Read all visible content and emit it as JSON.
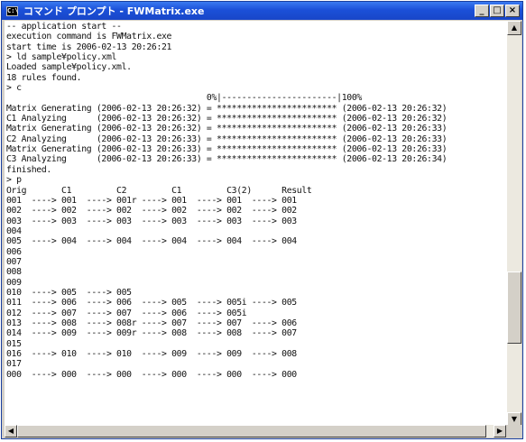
{
  "window": {
    "title": "コマンド プロンプト - FWMatrix.exe",
    "app_icon": "C:\\",
    "minimize_glyph": "_",
    "maximize_glyph": "□",
    "close_glyph": "×"
  },
  "console": {
    "lines": [
      "-- application start --",
      "execution command is FWMatrix.exe",
      "start time is 2006-02-13 20:26:21",
      "> ld sample¥policy.xml",
      "Loaded sample¥policy.xml.",
      "18 rules found.",
      "> c",
      "                                        0%|-----------------------|100%",
      "Matrix Generating (2006-02-13 20:26:32) = ************************ (2006-02-13 20:26:32)",
      "C1 Analyzing      (2006-02-13 20:26:32) = ************************ (2006-02-13 20:26:32)",
      "Matrix Generating (2006-02-13 20:26:32) = ************************ (2006-02-13 20:26:33)",
      "C2 Analyzing      (2006-02-13 20:26:33) = ************************ (2006-02-13 20:26:33)",
      "Matrix Generating (2006-02-13 20:26:33) = ************************ (2006-02-13 20:26:33)",
      "C3 Analyzing      (2006-02-13 20:26:33) = ************************ (2006-02-13 20:26:34)",
      "finished.",
      "> p",
      "Orig       C1         C2         C1         C3(2)      Result",
      "001  ----> 001  ----> 001r ----> 001  ----> 001  ----> 001",
      "002  ----> 002  ----> 002  ----> 002  ----> 002  ----> 002",
      "003  ----> 003  ----> 003  ----> 003  ----> 003  ----> 003",
      "004",
      "005  ----> 004  ----> 004  ----> 004  ----> 004  ----> 004",
      "006",
      "007",
      "008",
      "009",
      "010  ----> 005  ----> 005",
      "011  ----> 006  ----> 006  ----> 005  ----> 005i ----> 005",
      "012  ----> 007  ----> 007  ----> 006  ----> 005i",
      "013  ----> 008  ----> 008r ----> 007  ----> 007  ----> 006",
      "014  ----> 009  ----> 009r ----> 008  ----> 008  ----> 007",
      "015",
      "016  ----> 010  ----> 010  ----> 009  ----> 009  ----> 008",
      "017",
      "000  ----> 000  ----> 000  ----> 000  ----> 000  ----> 000"
    ]
  },
  "scrollbar": {
    "up_glyph": "▲",
    "down_glyph": "▼",
    "left_glyph": "◀",
    "right_glyph": "▶"
  }
}
